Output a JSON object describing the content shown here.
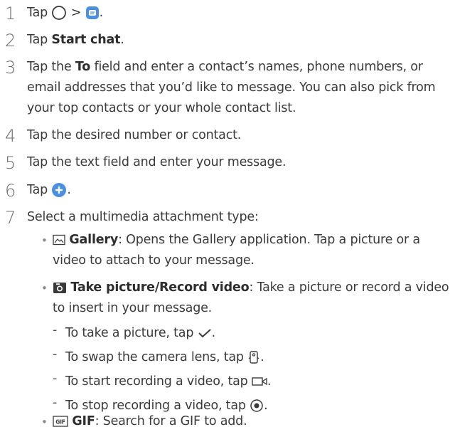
{
  "steps": [
    {
      "n": "1",
      "a": "Tap ",
      "sep": " > ",
      "end": "."
    },
    {
      "n": "2",
      "a": "Tap ",
      "b": "Start chat",
      "c": "."
    },
    {
      "n": "3",
      "a": "Tap the ",
      "b": "To",
      "c": " field and enter a contact’s names, phone numbers, or email addresses that you’d like to message. You can also pick from your top contacts or your whole contact list."
    },
    {
      "n": "4",
      "a": "Tap the desired number or contact."
    },
    {
      "n": "5",
      "a": "Tap the text field and enter your message."
    },
    {
      "n": "6",
      "a": "Tap ",
      "end": "."
    },
    {
      "n": "7",
      "a": "Select a multimedia attachment type:"
    }
  ],
  "attachments": [
    {
      "b": "Gallery",
      "c": ": Opens the Gallery application. Tap a picture or a video to attach to your message."
    },
    {
      "b": "Take picture/Record video",
      "c": ": Take a picture or record a video to insert in your message."
    },
    {
      "b": "GIF",
      "c": ": Search for a GIF to add."
    }
  ],
  "camera_steps": [
    {
      "a": "To take a picture, tap ",
      "end": "."
    },
    {
      "a": "To swap the camera lens, tap ",
      "end": "."
    },
    {
      "a": "To start recording a video, tap ",
      "end": "."
    },
    {
      "a": "To stop recording a video, tap ",
      "end": "."
    }
  ],
  "icons": {
    "home": "home-circle-icon",
    "messages": "messages-app-icon",
    "add": "plus-circle-icon",
    "gallery": "gallery-icon",
    "camera": "camera-icon",
    "gif": "gif-icon",
    "check": "checkmark-icon",
    "swap": "swap-camera-icon",
    "record": "record-video-icon",
    "stop": "stop-record-icon"
  },
  "colors": {
    "accent": "#4a8fe0",
    "text": "#3a3a3a"
  }
}
